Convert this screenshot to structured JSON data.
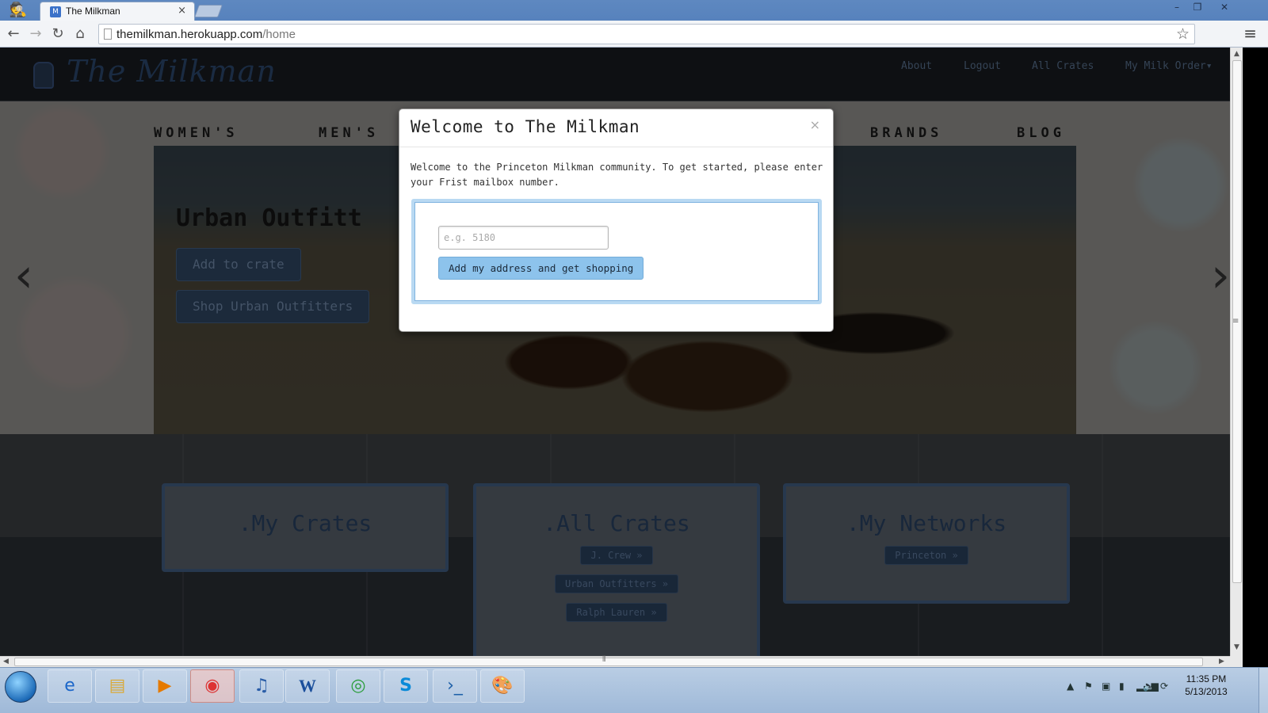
{
  "browser": {
    "tab_title": "The Milkman",
    "url_host": "themilkman.herokuapp.com",
    "url_path": "/home",
    "tab_close": "×"
  },
  "site": {
    "brand": "The Milkman",
    "nav": [
      "About",
      "Logout",
      "All Crates",
      "My Milk Order▾"
    ],
    "categories": [
      "WOMEN'S",
      "MEN'S",
      "BRANDS",
      "BLOG"
    ]
  },
  "hero": {
    "heading": "Urban Outfitt",
    "add_button": "Add to crate",
    "shop_button": "Shop Urban Outfitters",
    "prev_arrow": "‹",
    "next_arrow": "›"
  },
  "panels": {
    "my_crates": {
      "title": ".My Crates"
    },
    "all_crates": {
      "title": ".All Crates",
      "items": [
        "J. Crew »",
        "Urban Outfitters »",
        "Ralph Lauren »"
      ]
    },
    "my_networks": {
      "title": ".My Networks",
      "items": [
        "Princeton »"
      ]
    }
  },
  "modal": {
    "title": "Welcome to The Milkman",
    "close": "×",
    "text": "Welcome to the Princeton Milkman community. To get started, please enter your Frist mailbox number.",
    "input_placeholder": "e.g. 5180",
    "input_value": "",
    "submit_label": "Add my address and get shopping"
  },
  "taskbar": {
    "time": "11:35 PM",
    "date": "5/13/2013"
  }
}
